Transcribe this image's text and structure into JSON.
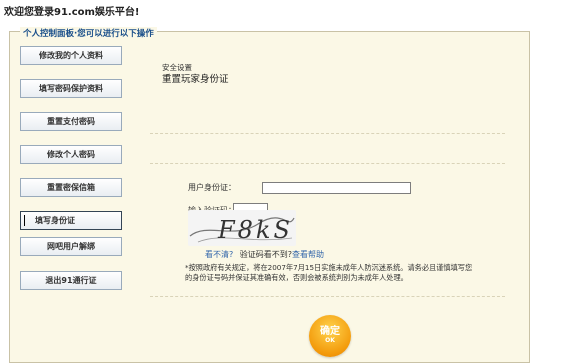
{
  "welcome": "欢迎您登录91.com娱乐平台!",
  "panel_title": "个人控制面板·您可以进行以下操作",
  "menu": [
    {
      "label": "修改我的个人资料"
    },
    {
      "label": "填写密码保护资料"
    },
    {
      "label": "重置支付密码"
    },
    {
      "label": "修改个人密码"
    },
    {
      "label": "重置密保信箱"
    },
    {
      "label": "填写身份证"
    },
    {
      "label": "网吧用户解绑"
    },
    {
      "label": "退出91通行证"
    }
  ],
  "section": {
    "small": "安全设置",
    "title": "重置玩家身份证"
  },
  "form": {
    "id_label": "用户身份证：",
    "id_value": "",
    "captcha_label": "输入验证码：",
    "captcha_value": "",
    "captcha_text": "F8kS",
    "link_unclear": "看不清?",
    "link_sep": "验证码看不到?",
    "link_help": "查看帮助"
  },
  "note": "*按照政府有关规定，将在2007年7月15日实施未成年人防沉迷系统。请务必且谨慎填写您的身份证号码并保证其准确有效，否则会被系统判别为未成年人处理。",
  "confirm": {
    "label": "确定",
    "sub": "OK"
  }
}
